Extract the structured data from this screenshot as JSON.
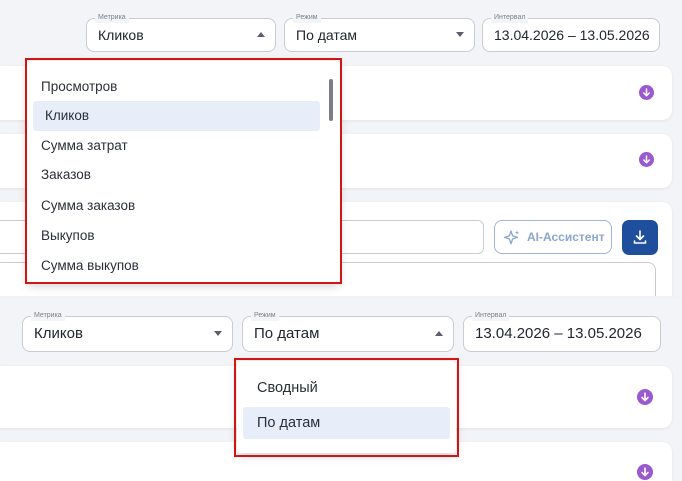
{
  "labels": {
    "metric": "Метрика",
    "mode": "Режим",
    "interval": "Интервал"
  },
  "top": {
    "metric_value": "Кликов",
    "mode_value": "По датам",
    "interval_value": "13.04.2026 – 13.05.2026",
    "metric_menu": {
      "items": [
        "Просмотров",
        "Кликов",
        "Сумма затрат",
        "Заказов",
        "Сумма заказов",
        "Выкупов",
        "Сумма выкупов"
      ],
      "selected": "Кликов"
    },
    "ai_assistant_label": "AI-Ассистент"
  },
  "bottom": {
    "metric_value": "Кликов",
    "mode_value": "По датам",
    "interval_value": "13.04.2026 – 13.05.2026",
    "mode_menu": {
      "items": [
        "Сводный",
        "По датам"
      ],
      "selected": "По датам"
    }
  },
  "colors": {
    "accent_purple": "#9b59d0",
    "highlight_red": "#d11515",
    "download_blue": "#1f4f9c",
    "selected_item_bg": "#e7eef9"
  },
  "icons": [
    "chevron-up-icon",
    "chevron-down-icon",
    "arrow-down-circle-icon",
    "sparkle-icon",
    "download-icon"
  ]
}
